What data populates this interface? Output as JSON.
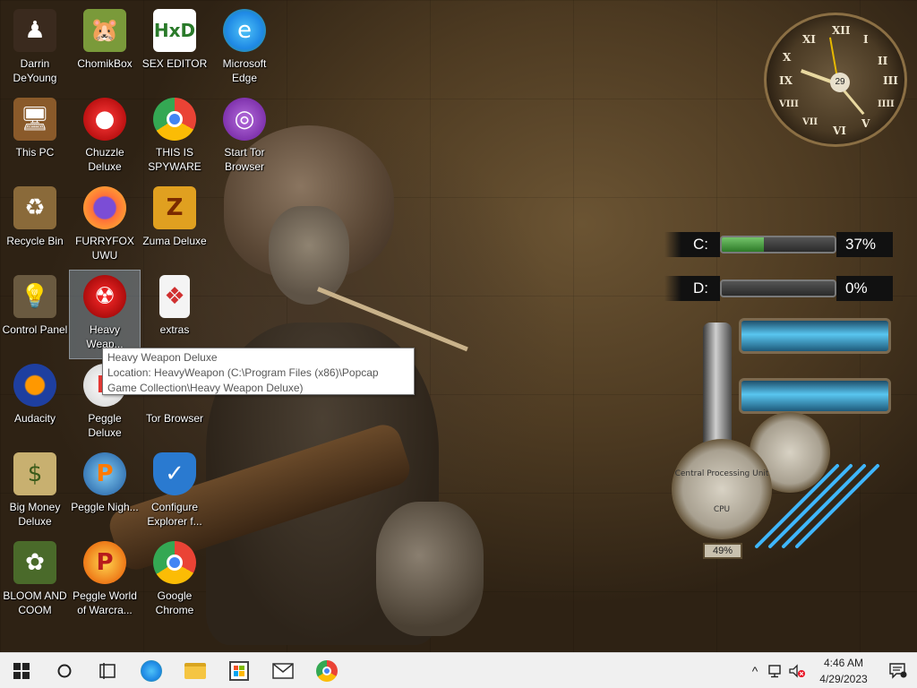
{
  "desktop": {
    "icons": [
      {
        "label": "Darrin DeYoung",
        "icon": "person-portrait-icon"
      },
      {
        "label": "ChomikBox",
        "icon": "hamster-box-icon"
      },
      {
        "label": "SEX EDITOR",
        "icon": "hxd-editor-icon"
      },
      {
        "label": "Microsoft Edge",
        "icon": "edge-icon"
      },
      {
        "label": "This PC",
        "icon": "computer-icon"
      },
      {
        "label": "Chuzzle Deluxe",
        "icon": "chuzzle-icon"
      },
      {
        "label": "THIS IS SPYWARE",
        "icon": "chrome-icon"
      },
      {
        "label": "Start Tor Browser",
        "icon": "tor-icon"
      },
      {
        "label": "Recycle Bin",
        "icon": "recycle-bin-icon"
      },
      {
        "label": "FURRYFOX UWU",
        "icon": "firefox-icon"
      },
      {
        "label": "Zuma Deluxe",
        "icon": "zuma-icon"
      },
      {
        "label": "Control Panel",
        "icon": "control-panel-icon"
      },
      {
        "label": "Heavy Weap...",
        "icon": "heavy-weapon-icon"
      },
      {
        "label": "extras",
        "icon": "file-icon"
      },
      {
        "label": "Audacity",
        "icon": "audacity-icon"
      },
      {
        "label": "Peggle Deluxe",
        "icon": "peggle-icon"
      },
      {
        "label": "Tor Browser",
        "icon": "folder-icon"
      },
      {
        "label": "Big Money Deluxe",
        "icon": "money-bag-icon"
      },
      {
        "label": "Peggle Nigh...",
        "icon": "peggle-nights-icon"
      },
      {
        "label": "Configure Explorer f...",
        "icon": "shield-icon"
      },
      {
        "label": "BLOOM AND COOM",
        "icon": "flower-icon"
      },
      {
        "label": "Peggle World of Warcra...",
        "icon": "peggle-wow-icon"
      },
      {
        "label": "Google Chrome",
        "icon": "chrome-icon"
      }
    ],
    "tooltip": "Heavy Weapon Deluxe\nLocation: HeavyWeapon (C:\\Program Files (x86)\\Popcap Game Collection\\Heavy Weapon Deluxe)"
  },
  "widgets": {
    "clock": {
      "numerals": [
        "XII",
        "I",
        "II",
        "III",
        "IIII",
        "V",
        "VI",
        "VII",
        "VIII",
        "IX",
        "X",
        "XI"
      ],
      "date": "29"
    },
    "drives": [
      {
        "label": "C:",
        "percent_text": "37%",
        "percent": 37
      },
      {
        "label": "D:",
        "percent_text": "0%",
        "percent": 0
      }
    ],
    "gauge": {
      "title": "Central Processing Unit",
      "unit": "CPU",
      "percent_text": "49%"
    }
  },
  "taskbar": {
    "start_icon": "windows-logo-icon",
    "search_icon": "cortana-circle-icon",
    "task_view_icon": "task-view-icon",
    "pinned": [
      "edge-icon",
      "file-explorer-icon",
      "microsoft-store-icon",
      "mail-icon",
      "chrome-icon"
    ],
    "tray": {
      "chevron": "^",
      "time": "4:46 AM",
      "date": "4/29/2023"
    }
  },
  "colors": {
    "taskbar_bg": "#f0f0f0",
    "drive_fill": "#4caf50",
    "tube_blue": "#59c6f0"
  }
}
